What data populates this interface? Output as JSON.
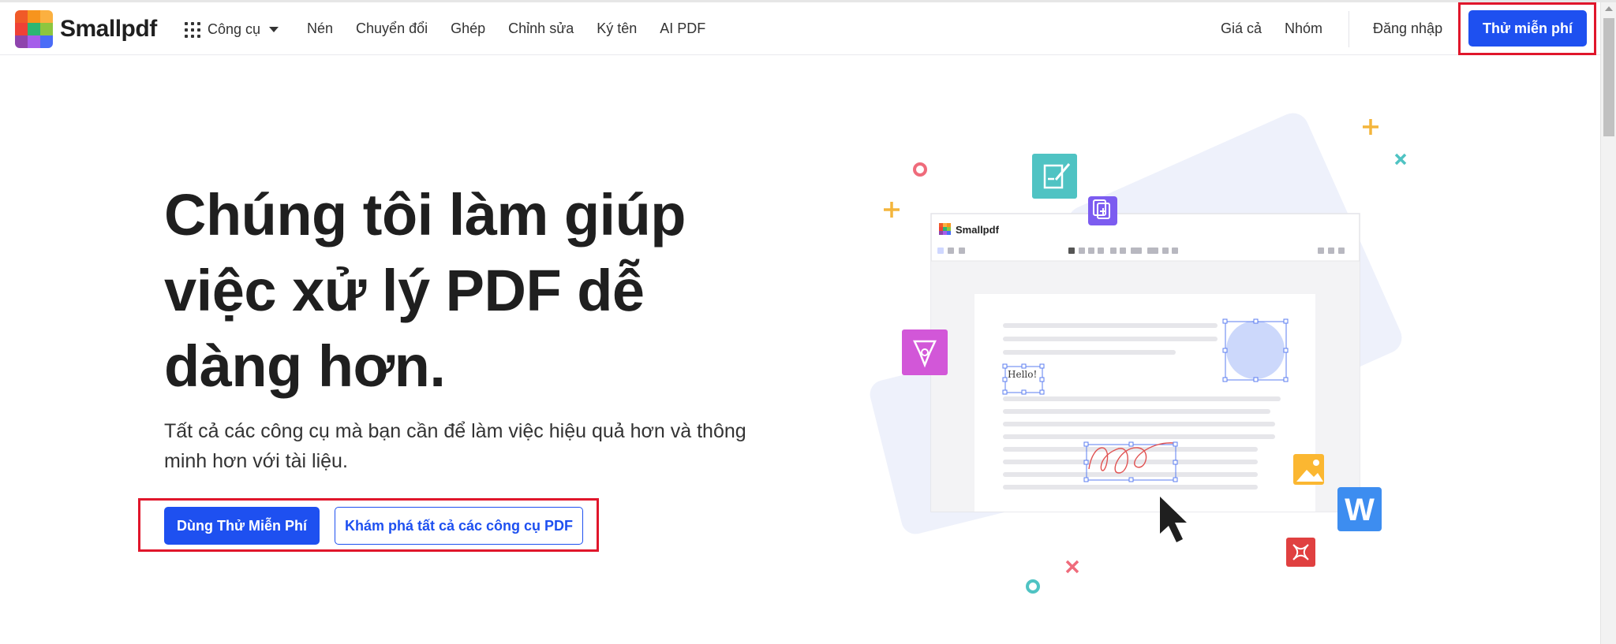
{
  "header": {
    "brand": "Smallpdf",
    "tools_label": "Công cụ",
    "nav": [
      "Nén",
      "Chuyển đổi",
      "Ghép",
      "Chỉnh sửa",
      "Ký tên",
      "AI PDF"
    ],
    "right_nav": [
      "Giá cả",
      "Nhóm"
    ],
    "login": "Đăng nhập",
    "try_free": "Thử miễn phí"
  },
  "hero": {
    "title": "Chúng tôi làm giúp việc xử lý PDF dễ dàng hơn.",
    "subtitle": "Tất cả các công cụ mà bạn cần để làm việc hiệu quả hơn và thông minh hơn với tài liệu.",
    "cta_primary": "Dùng Thử Miễn Phí",
    "cta_secondary": "Khám phá tất cả các công cụ PDF"
  },
  "illustration": {
    "editor_brand": "Smallpdf",
    "hello_text": "Hello!",
    "word_letter": "W"
  },
  "colors": {
    "brand_blue": "#1e50f0",
    "highlight_red": "#e0162b",
    "logo": [
      "#f05a28",
      "#f7941d",
      "#fbb040",
      "#ef4136",
      "#2bb673",
      "#8dc63f",
      "#8e44ad",
      "#a55eea",
      "#4a6cf7"
    ]
  },
  "icons": [
    "grid-icon",
    "caret-down-icon",
    "edit-doc-icon",
    "copy-icon",
    "pen-nib-icon",
    "image-icon",
    "word-icon",
    "acrobat-icon",
    "cursor-icon"
  ]
}
